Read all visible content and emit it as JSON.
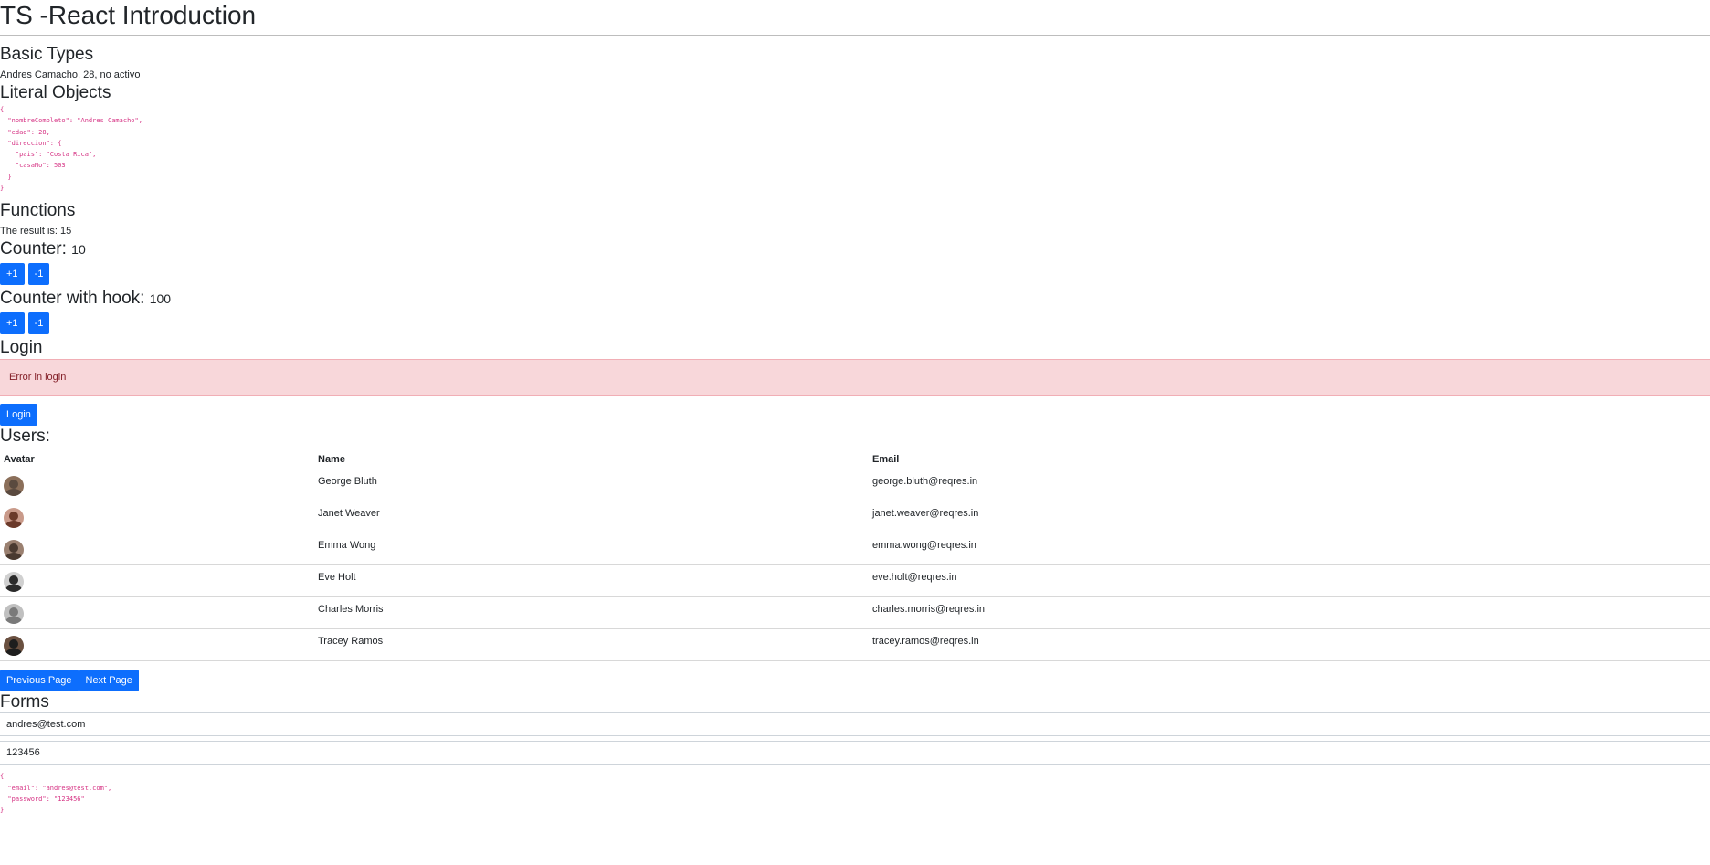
{
  "page": {
    "title": "TS -React Introduction"
  },
  "basic_types": {
    "heading": "Basic Types",
    "text": "Andres Camacho, 28, no activo"
  },
  "literal_objects": {
    "heading": "Literal Objects",
    "json": "{\n  \"nombreCompleto\": \"Andres Camacho\",\n  \"edad\": 28,\n  \"direccion\": {\n    \"pais\": \"Costa Rica\",\n    \"casaNo\": 503\n  }\n}"
  },
  "functions": {
    "heading": "Functions",
    "result_text": "The result is: 15"
  },
  "counter": {
    "label": "Counter:",
    "value": "10",
    "inc_label": "+1",
    "dec_label": "-1"
  },
  "counter_hook": {
    "label": "Counter with hook:",
    "value": "100",
    "inc_label": "+1",
    "dec_label": "-1"
  },
  "login": {
    "heading": "Login",
    "error_text": "Error in login",
    "button_label": "Login"
  },
  "users": {
    "heading": "Users:",
    "columns": [
      "Avatar",
      "Name",
      "Email"
    ],
    "rows": [
      {
        "name": "George Bluth",
        "email": "george.bluth@reqres.in",
        "avatar_colors": [
          "#5a4a3f",
          "#8b6f5a"
        ]
      },
      {
        "name": "Janet Weaver",
        "email": "janet.weaver@reqres.in",
        "avatar_colors": [
          "#6b3a2a",
          "#c99a8a"
        ]
      },
      {
        "name": "Emma Wong",
        "email": "emma.wong@reqres.in",
        "avatar_colors": [
          "#4a3a30",
          "#9a8070"
        ]
      },
      {
        "name": "Eve Holt",
        "email": "eve.holt@reqres.in",
        "avatar_colors": [
          "#2a2a2a",
          "#d0d0d0"
        ]
      },
      {
        "name": "Charles Morris",
        "email": "charles.morris@reqres.in",
        "avatar_colors": [
          "#7a7a7a",
          "#c0c0c0"
        ]
      },
      {
        "name": "Tracey Ramos",
        "email": "tracey.ramos@reqres.in",
        "avatar_colors": [
          "#1e1e1e",
          "#6a5040"
        ]
      }
    ],
    "prev_label": "Previous Page",
    "next_label": "Next Page"
  },
  "forms": {
    "heading": "Forms",
    "email_value": "andres@test.com",
    "password_value": "123456",
    "json": "{\n  \"email\": \"andres@test.com\",\n  \"password\": \"123456\"\n}"
  },
  "colors": {
    "primary": "#0d6efd",
    "danger_bg": "#f8d7da",
    "code": "#d63384"
  }
}
